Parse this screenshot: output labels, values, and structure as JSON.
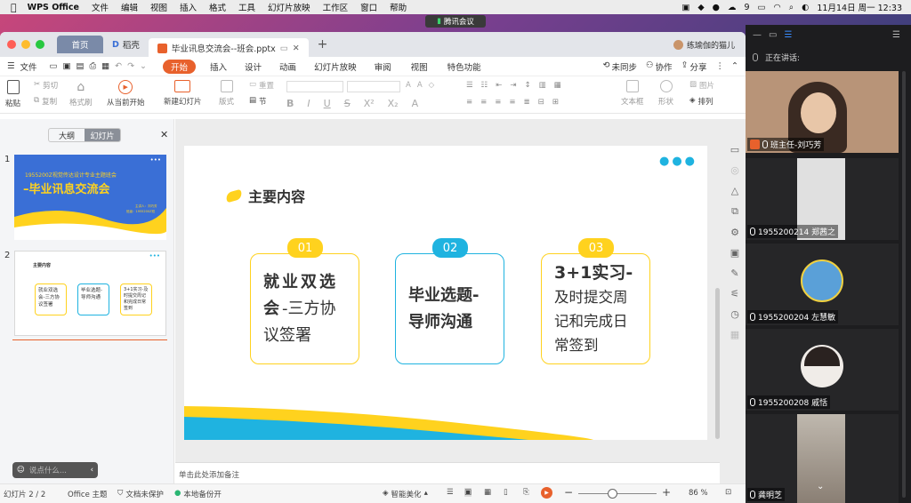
{
  "menubar": {
    "app": "WPS Office",
    "items": [
      "文件",
      "编辑",
      "视图",
      "插入",
      "格式",
      "工具",
      "幻灯片放映",
      "工作区",
      "窗口",
      "帮助"
    ],
    "battery": "9",
    "datetime": "11月14日 周一  12:33"
  },
  "meeting": {
    "label": "腾讯会议"
  },
  "tabs": {
    "home": "首页",
    "docer": "稻壳",
    "file": "毕业讯息交流会--班会.pptx",
    "user": "练瑜伽的猫儿"
  },
  "ribbon": {
    "file": "文件",
    "tabs": [
      "开始",
      "插入",
      "设计",
      "动画",
      "幻灯片放映",
      "审阅",
      "视图",
      "特色功能"
    ],
    "right": {
      "sync": "未同步",
      "collab": "协作",
      "share": "分享"
    }
  },
  "toolbar": {
    "paste": "粘贴",
    "cut": "剪切",
    "copy": "复制",
    "format_painter": "格式刷",
    "play_from_current": "从当前开始",
    "new_slide": "新建幻灯片",
    "layout": "版式",
    "section": "节",
    "reset": "重置",
    "textbox": "文本框",
    "shape": "形状",
    "picture": "图片",
    "arrange": "排列"
  },
  "panel": {
    "outline": "大纲",
    "slides": "幻灯片",
    "thumb1": {
      "num": "1",
      "subtitle": "1955200Z视觉传达设计专业主题班会",
      "title": "–毕业讯息交流会",
      "line1": "主讲人：刘巧芳",
      "line2": "班级：1955200Z班"
    },
    "thumb2": {
      "num": "2",
      "heading": "主要内容",
      "c1": "就业双选会-三方协议签署",
      "c2": "毕业选题-导师沟通",
      "c3": "3+1实习-及时提交周记和完成日常签到"
    }
  },
  "slide": {
    "heading": "主要内容",
    "cards": [
      {
        "num": "01",
        "bold": "就业双选会",
        "rest": "-三方协议签署"
      },
      {
        "num": "02",
        "bold": "毕业选题-导师沟通",
        "rest": ""
      },
      {
        "num": "03",
        "bold": "3+1实习-",
        "rest": "及时提交周记和完成日常签到"
      }
    ],
    "notes": "单击此处添加备注"
  },
  "chat": {
    "placeholder": "说点什么..."
  },
  "status": {
    "slide_count": "幻灯片 2 / 2",
    "theme": "Office 主题",
    "protect": "文档未保护",
    "backup": "本地备份开",
    "beautify": "智能美化",
    "zoom": "86 %"
  },
  "meeting_panel": {
    "speaking": "正在讲话:",
    "participants": [
      {
        "name": "班主任-刘巧芳",
        "host": true
      },
      {
        "name": "1955200214 郑茜之",
        "host": false
      },
      {
        "name": "1955200204 左慧敏",
        "host": false
      },
      {
        "name": "1955200208 戚恬",
        "host": false
      },
      {
        "name": "龚明芝",
        "host": false
      }
    ]
  },
  "colors": {
    "yellow": "#ffd21e",
    "cyan": "#1fb3e0",
    "accent": "#e8612c",
    "blue": "#3a6fd6"
  }
}
